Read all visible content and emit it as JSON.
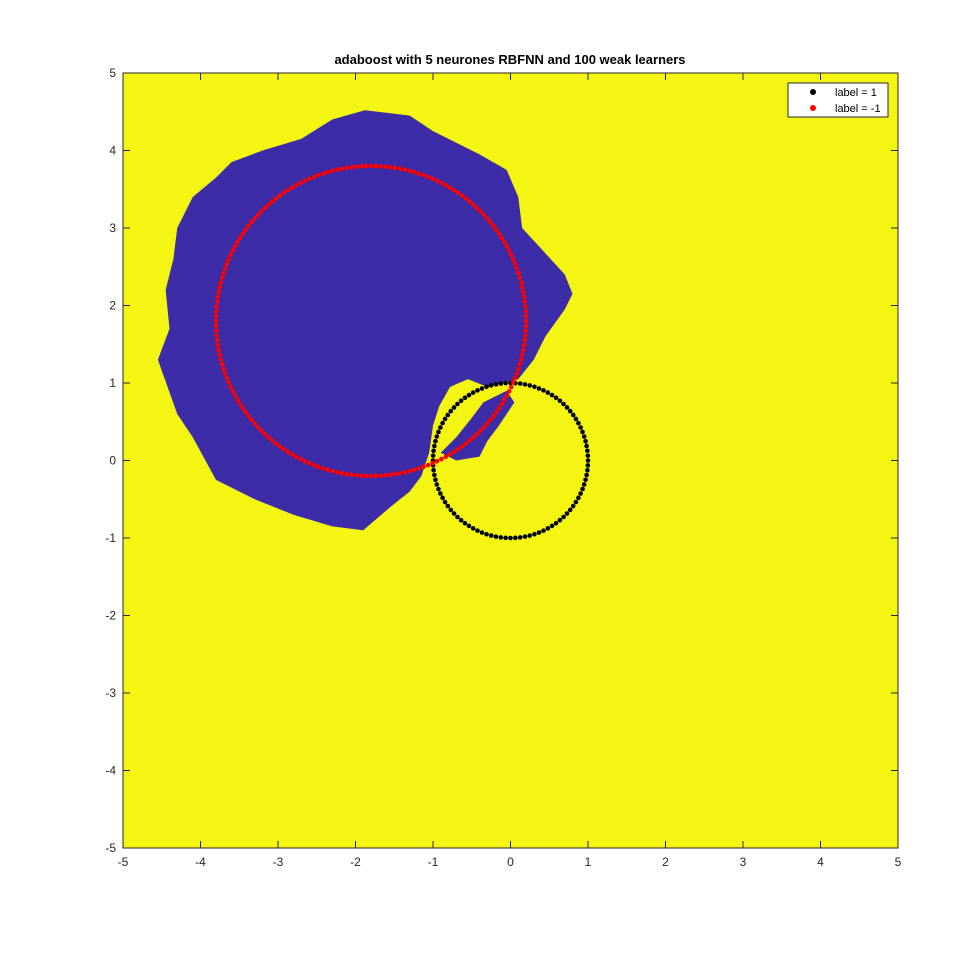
{
  "chart_data": {
    "type": "scatter",
    "title": "adaboost with 5 neurones RBFNN and 100 weak learners",
    "xlabel": "",
    "ylabel": "",
    "xlim": [
      -5,
      5
    ],
    "ylim": [
      -5,
      5
    ],
    "xticks": [
      -5,
      -4,
      -3,
      -2,
      -1,
      0,
      1,
      2,
      3,
      4,
      5
    ],
    "yticks": [
      -5,
      -4,
      -3,
      -2,
      -1,
      0,
      1,
      2,
      3,
      4,
      5
    ],
    "grid": false,
    "legend_position": "top-right",
    "background": {
      "type": "decision-region",
      "colors": {
        "positive_region": "#f5f514",
        "negative_region": "#3c2ca8"
      },
      "negative_region_boundary": [
        [
          -1.88,
          4.52
        ],
        [
          -1.3,
          4.45
        ],
        [
          -1.0,
          4.25
        ],
        [
          -0.7,
          4.1
        ],
        [
          -0.4,
          3.95
        ],
        [
          -0.05,
          3.75
        ],
        [
          0.1,
          3.4
        ],
        [
          0.15,
          3.0
        ],
        [
          0.38,
          2.75
        ],
        [
          0.7,
          2.4
        ],
        [
          0.8,
          2.15
        ],
        [
          0.7,
          1.95
        ],
        [
          0.45,
          1.6
        ],
        [
          0.3,
          1.3
        ],
        [
          0.1,
          1.05
        ],
        [
          -0.3,
          0.95
        ],
        [
          -0.55,
          1.05
        ],
        [
          -0.78,
          0.95
        ],
        [
          -0.92,
          0.7
        ],
        [
          -1.0,
          0.45
        ],
        [
          -1.05,
          0.1
        ],
        [
          -1.15,
          -0.2
        ],
        [
          -1.3,
          -0.4
        ],
        [
          -1.55,
          -0.6
        ],
        [
          -1.9,
          -0.9
        ],
        [
          -2.3,
          -0.85
        ],
        [
          -2.8,
          -0.7
        ],
        [
          -3.3,
          -0.5
        ],
        [
          -3.8,
          -0.25
        ],
        [
          -4.1,
          0.3
        ],
        [
          -4.3,
          0.6
        ],
        [
          -4.55,
          1.3
        ],
        [
          -4.4,
          1.7
        ],
        [
          -4.45,
          2.2
        ],
        [
          -4.35,
          2.6
        ],
        [
          -4.3,
          3.0
        ],
        [
          -4.1,
          3.4
        ],
        [
          -3.8,
          3.65
        ],
        [
          -3.6,
          3.85
        ],
        [
          -3.2,
          4.0
        ],
        [
          -2.7,
          4.15
        ],
        [
          -2.3,
          4.4
        ]
      ],
      "inner_patch": [
        [
          -0.05,
          0.9
        ],
        [
          0.05,
          0.75
        ],
        [
          -0.15,
          0.45
        ],
        [
          -0.3,
          0.25
        ],
        [
          -0.4,
          0.05
        ],
        [
          -0.7,
          0.0
        ],
        [
          -0.9,
          0.1
        ],
        [
          -0.7,
          0.3
        ],
        [
          -0.5,
          0.55
        ],
        [
          -0.35,
          0.75
        ]
      ]
    },
    "series": [
      {
        "name": "label = 1",
        "color": "#000000",
        "shape": "circle",
        "center": [
          0,
          0
        ],
        "radius": 1,
        "count": 100
      },
      {
        "name": "label = -1",
        "color": "#ff0000",
        "shape": "circle",
        "center": [
          -1.8,
          1.8
        ],
        "radius": 2,
        "count": 200
      }
    ]
  }
}
